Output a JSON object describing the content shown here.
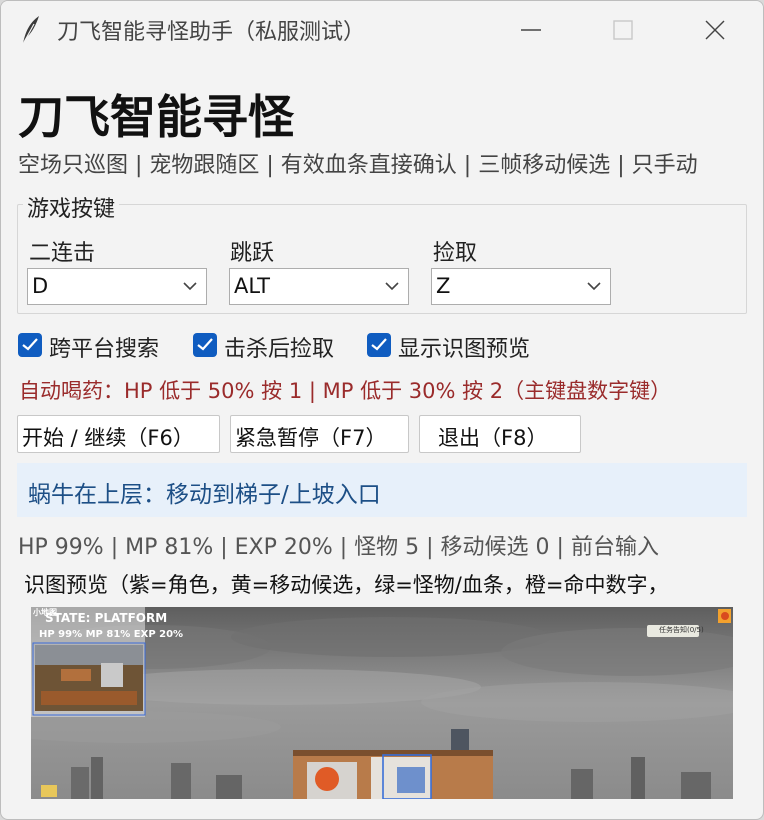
{
  "window": {
    "title": "刀飞智能寻怪助手（私服测试）",
    "icon": "feather-icon"
  },
  "app": {
    "title": "刀飞智能寻怪",
    "tagline": "空场只巡图 | 宠物跟随区 | 有效血条直接确认 | 三帧移动候选 | 只手动"
  },
  "keys": {
    "legend": "游戏按键",
    "items": [
      {
        "label": "二连击",
        "value": "D"
      },
      {
        "label": "跳跃",
        "value": "ALT"
      },
      {
        "label": "捡取",
        "value": "Z"
      }
    ]
  },
  "options": [
    {
      "label": "跨平台搜索",
      "checked": true
    },
    {
      "label": "击杀后捡取",
      "checked": true
    },
    {
      "label": "显示识图预览",
      "checked": true
    }
  ],
  "potion_text": "自动喝药：HP 低于 50% 按 1 | MP 低于 30% 按 2（主键盘数字键）",
  "buttons": {
    "start": "开始 / 继续（F6）",
    "pause": "紧急暂停（F7）",
    "exit": "退出（F8）"
  },
  "status": "蜗牛在上层：移动到梯子/上坡入口",
  "stats": "HP 99% | MP 81% | EXP 20% | 怪物 5 | 移动候选 0 | 前台输入",
  "preview": {
    "label": "识图预览（紫=角色，黄=移动候选，绿=怪物/血条，橙=命中数字，",
    "state_text": "STATE: PLATFORM",
    "stats_text": "HP 99% MP 81% EXP 20%",
    "minimap_title": "小地图",
    "quest_text": "任务告知(0/5)"
  },
  "colors": {
    "accent": "#0f5cc0",
    "warning": "#9a2b2b",
    "status_text": "#1d4f86",
    "status_bg": "#e7f0fa"
  }
}
